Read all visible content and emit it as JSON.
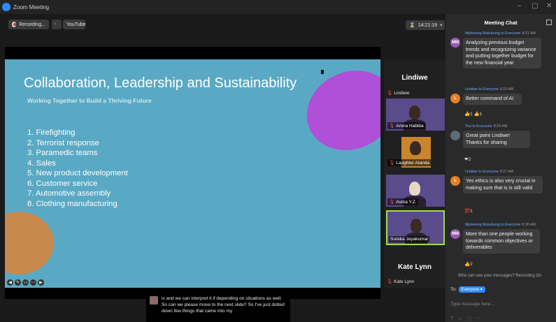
{
  "window": {
    "title": "Zoom Meeting"
  },
  "toolbar": {
    "recording_label": "Recording...",
    "youtube_label": "YouTube",
    "time": "14:21:19"
  },
  "slide": {
    "title": "Collaboration, Leadership and Sustainability",
    "subtitle": "Working Together to Build a Thriving Future",
    "items": [
      "1. Firefighting",
      "2. Terrorist response",
      "3. Paramedic teams",
      "4. Sales",
      "5. New product development",
      "6. Customer service",
      "7. Automotive assembly",
      "8. Clothing manufacturing"
    ]
  },
  "gallery": {
    "top_name": "Lindiwe",
    "lindiwe_line": "Lindiwe",
    "tiles": [
      "Amna Habiba",
      "Laughter Atanda",
      "Asma Y.Z.",
      "Sureka Jeyakumar"
    ],
    "bottom_name": "Kate Lynn",
    "kate_line": "Kate Lynn"
  },
  "caption": {
    "text": "is and we can interpret it if depending on situations as well. So can we please move to the next slide? So I've just dotted down few things that came into my"
  },
  "chat": {
    "title": "Meeting Chat",
    "messages": [
      {
        "sender_line": "Mpheteng Mokubung to Everyone",
        "time": "8:21 AM",
        "initials": "MM",
        "text": "Analyzing previous budget trends and recognizing variance and putting together budget for the new financial year",
        "reaction": ""
      },
      {
        "sender_line": "Lindiwe to Everyone",
        "time": "8:23 AM",
        "initials": "L",
        "text": "Better command of AI",
        "reaction": "👍1  👍1"
      },
      {
        "sender_line": "You to Everyone",
        "time": "8:24 AM",
        "initials": "",
        "text": "Great point Lindiwe! Thanks for sharing",
        "reaction": "❤2"
      },
      {
        "sender_line": "Lindiwe to Everyone",
        "time": "8:27 AM",
        "initials": "L",
        "text": "Yes ethics is also very crucial in making sure that is is still valid",
        "reaction": "💯1"
      },
      {
        "sender_line": "Mpheteng Mokubung to Everyone",
        "time": "8:38 AM",
        "initials": "MM",
        "text": "More than one people working towards common objectives or deliverables",
        "reaction": "👍2"
      }
    ],
    "visibility_text": "Who can see your messages? Recording On",
    "to_label": "To:",
    "to_value": "Everyone",
    "input_placeholder": "Type message here..."
  },
  "colors": {
    "accent": "#2D8CFF",
    "slide_bg": "#5aa9c4",
    "purple_blob": "#b04fd7",
    "orange_blob": "#c7894c",
    "active_tile_border": "#9bdc5a"
  }
}
